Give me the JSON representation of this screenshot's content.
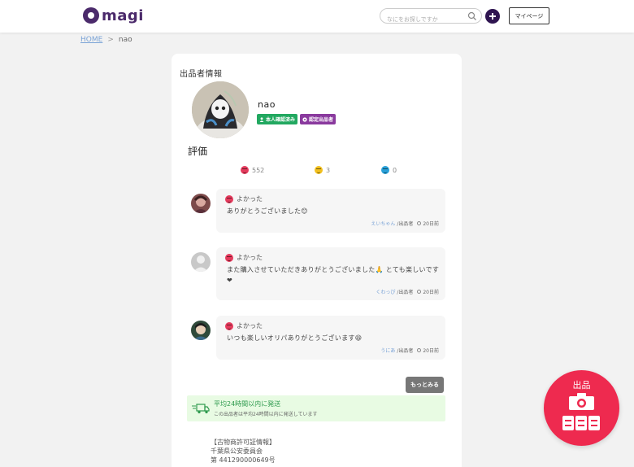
{
  "header": {
    "logo_text": "magi",
    "search_placeholder": "なにをお探しですか",
    "mypage_label": "マイページ"
  },
  "breadcrumb": {
    "home": "HOME",
    "separator": ">",
    "current": "nao"
  },
  "seller": {
    "section_title": "出品者情報",
    "name": "nao",
    "badges": [
      "本人確認済み",
      "認定出品者"
    ]
  },
  "evaluation": {
    "title": "評価",
    "good_count": "552",
    "normal_count": "3",
    "bad_count": "0"
  },
  "reviews": [
    {
      "rating_label": "よかった",
      "text": "ありがとうございました😊",
      "user": "えいちゃん",
      "role": "/出品者",
      "time": "20日前"
    },
    {
      "rating_label": "よかった",
      "text": "また購入させていただきありがとうございました🙏 とても楽しいです❤",
      "user": "くわっぴ",
      "role": "/出品者",
      "time": "20日前"
    },
    {
      "rating_label": "よかった",
      "text": "いつも楽しいオリパありがとうございます😆",
      "user": "うにあ",
      "role": "/出品者",
      "time": "20日前"
    }
  ],
  "more_label": "もっとみる",
  "shipping": {
    "title": "平均24時間以内に発送",
    "subtitle": "この出品者は平均24時間以内に発送しています"
  },
  "license": {
    "heading": "【古物商許可証情報】",
    "authority": "千葉県公安委員会",
    "number": "第 441290000649号"
  },
  "fab": {
    "label": "出品"
  },
  "colors": {
    "brand": "#4b2a6b",
    "accent": "#ee2a4f",
    "verified": "#22a860",
    "certified": "#8a3a9e"
  }
}
